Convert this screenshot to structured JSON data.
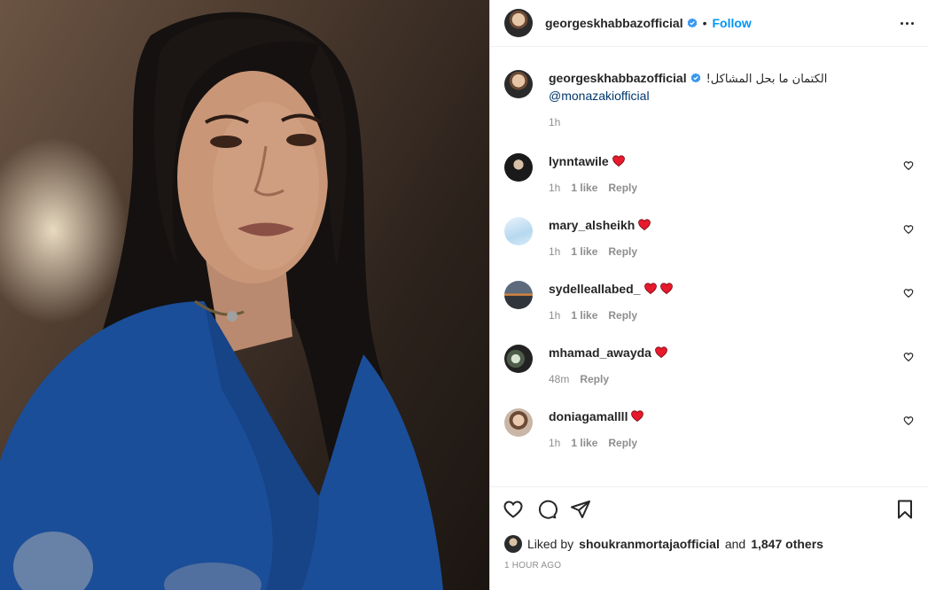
{
  "post": {
    "author": "georgeskhabbazofficial",
    "follow_label": "Follow",
    "separator": "•"
  },
  "caption": {
    "username": "georgeskhabbazofficial",
    "text": "الكتمان ما بحل المشاكل!",
    "mention": "@monazakiofficial",
    "time": "1h"
  },
  "comments": [
    {
      "username": "lynntawile",
      "hearts": 1,
      "time": "1h",
      "likes": "1 like",
      "reply": "Reply"
    },
    {
      "username": "mary_alsheikh",
      "hearts": 1,
      "time": "1h",
      "likes": "1 like",
      "reply": "Reply"
    },
    {
      "username": "sydelleallabed_",
      "hearts": 2,
      "time": "1h",
      "likes": "1 like",
      "reply": "Reply"
    },
    {
      "username": "mhamad_awayda",
      "hearts": 1,
      "time": "48m",
      "likes": "",
      "reply": "Reply"
    },
    {
      "username": "doniagamallll",
      "hearts": 1,
      "time": "1h",
      "likes": "1 like",
      "reply": "Reply"
    }
  ],
  "likes": {
    "prefix": "Liked by",
    "user": "shoukranmortajaofficial",
    "and": "and",
    "others": "1,847 others"
  },
  "timestamp": "1 HOUR AGO",
  "icons": {
    "verified": "verified-badge-icon",
    "more": "more-options-icon",
    "heart": "heart-icon",
    "comment": "comment-icon",
    "share": "share-icon",
    "save": "bookmark-icon"
  },
  "colors": {
    "accent": "#0095f6",
    "mention": "#00376b",
    "secondary_text": "#8e8e8e",
    "heart_emoji": "#e8192c",
    "verified": "#3897f0"
  }
}
